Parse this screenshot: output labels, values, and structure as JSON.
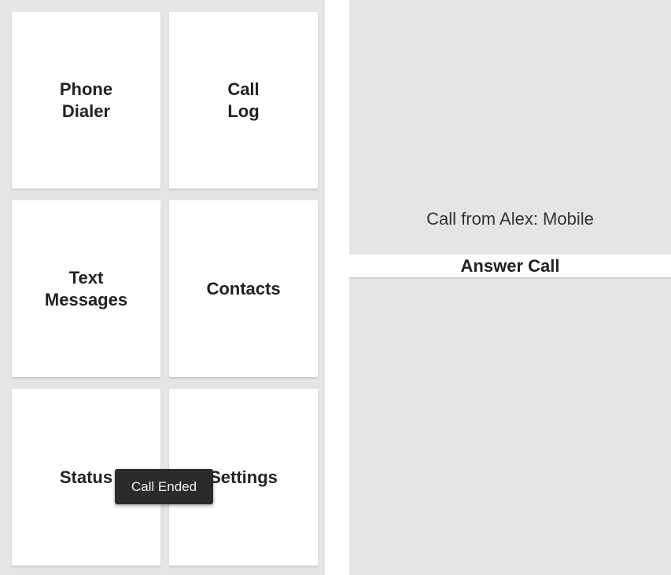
{
  "home": {
    "tiles": {
      "phone_dialer": "Phone\nDialer",
      "call_log": "Call\nLog",
      "text_messages": "Text\nMessages",
      "contacts": "Contacts",
      "status": "Status",
      "settings": "Settings"
    },
    "toast": "Call Ended"
  },
  "incoming_call": {
    "caller_text": "Call from Alex: Mobile",
    "answer_label": "Answer Call"
  },
  "colors": {
    "background": "#e5e5e5",
    "tile": "#ffffff",
    "toast": "#2b2b2b"
  }
}
